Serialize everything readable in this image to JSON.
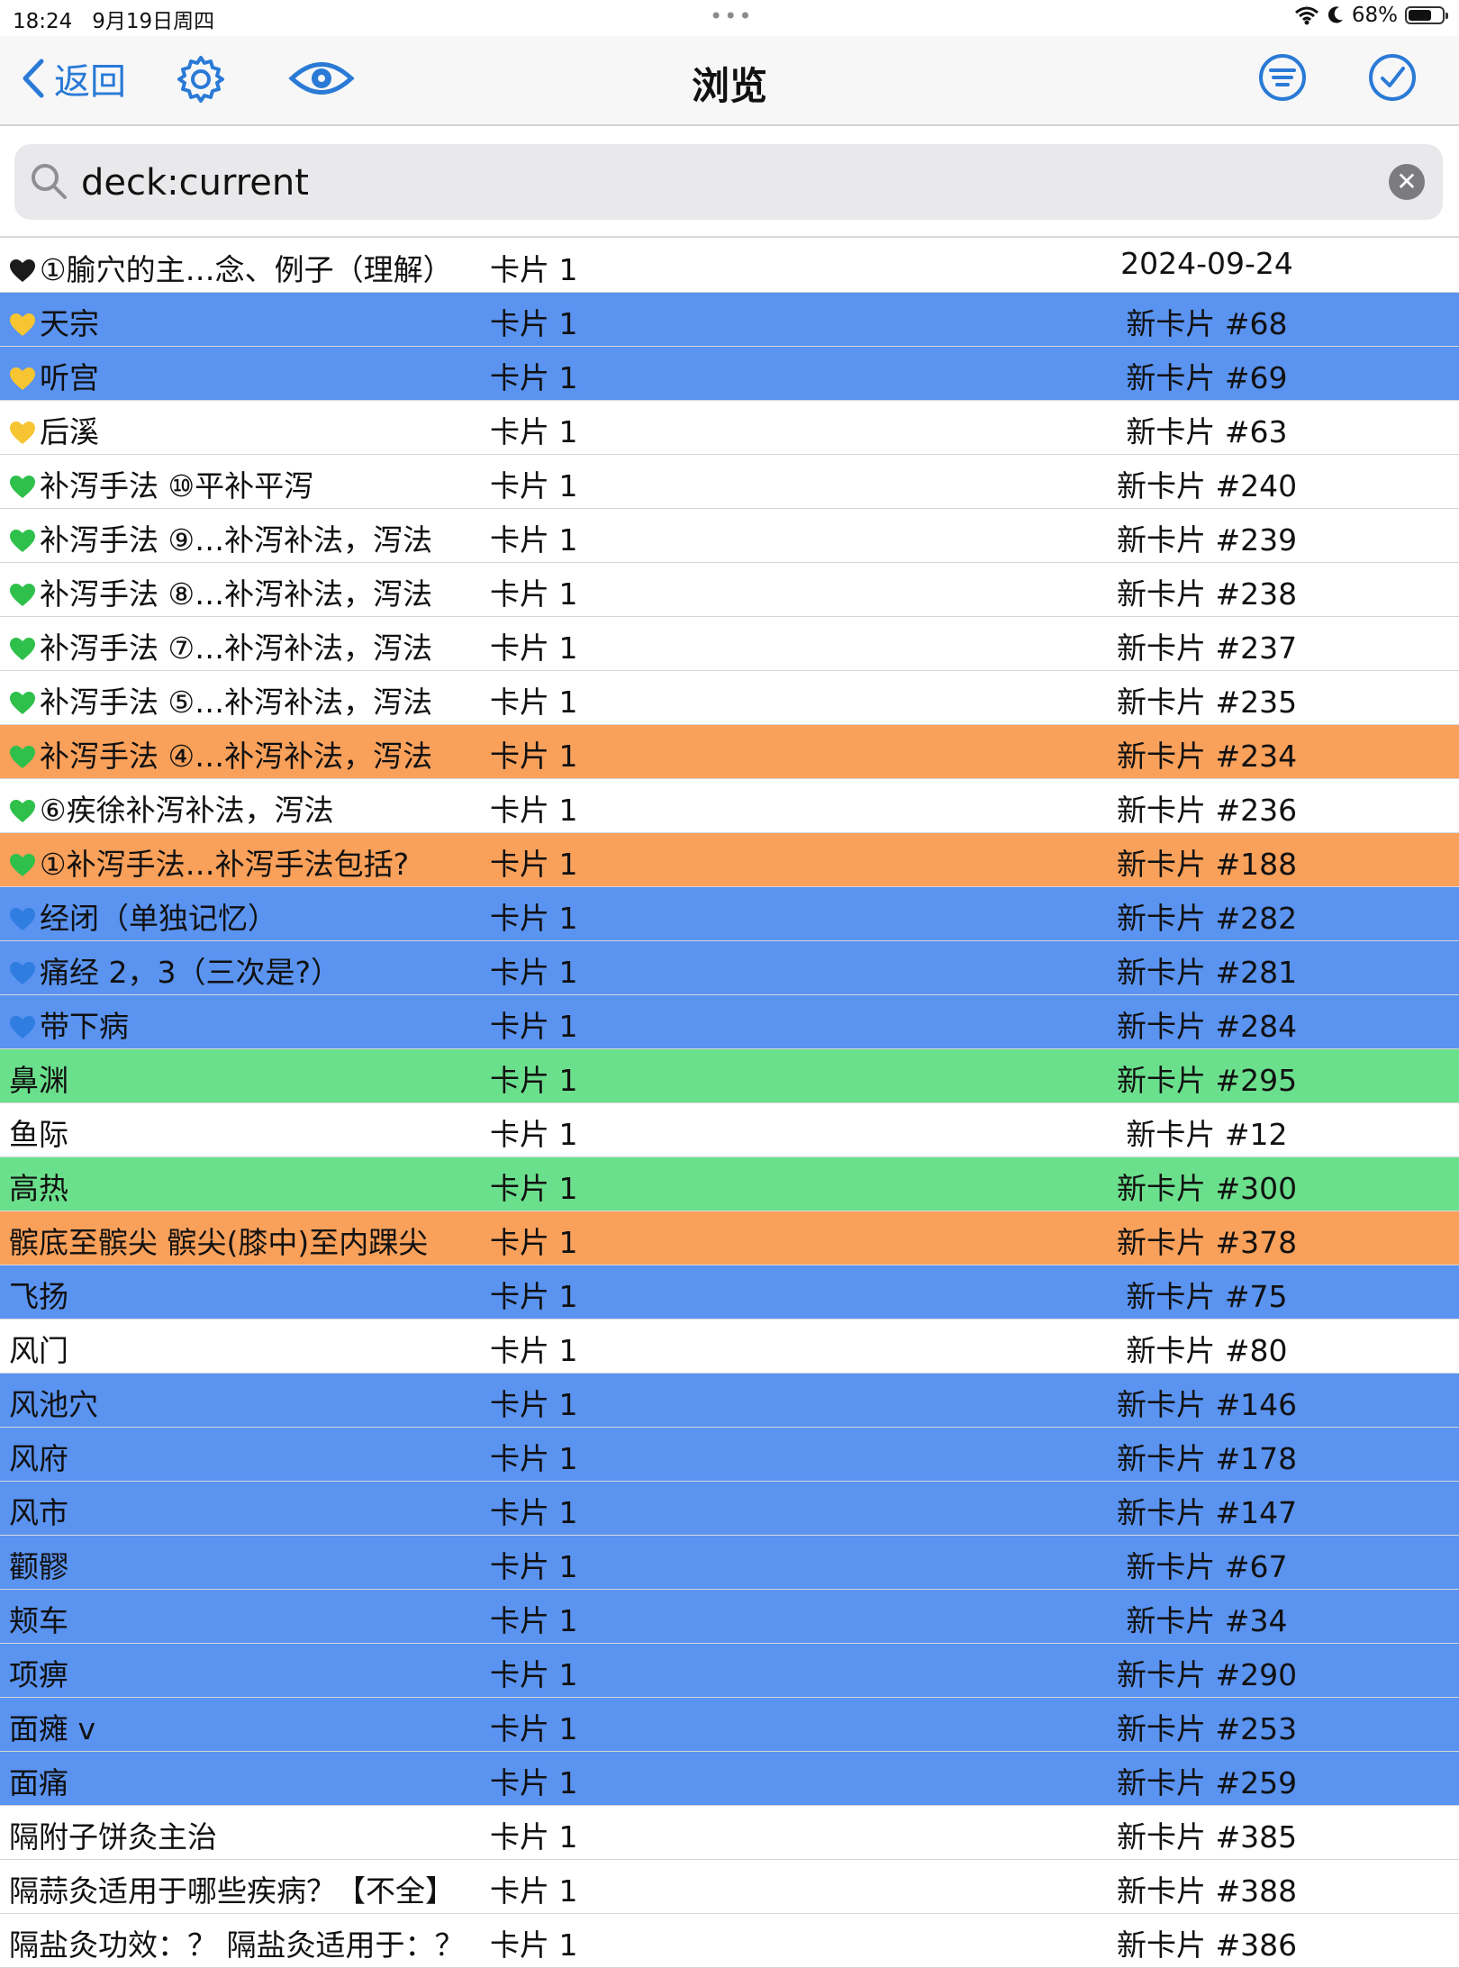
{
  "status": {
    "time": "18:24",
    "date": "9月19日周四",
    "battery": "68%"
  },
  "nav": {
    "back_label": "返回",
    "title": "浏览"
  },
  "search": {
    "value": "deck:current"
  },
  "colors": {
    "accent": "#2a7ad6",
    "blue": "#5a93f0",
    "orange": "#f9a05a",
    "green": "#6be08c",
    "white": "#ffffff"
  },
  "rows": [
    {
      "heart": "black",
      "label": "①腧穴的主…念、例子（理解）",
      "card": "卡片 1",
      "due": "2024-09-24",
      "bg": "white"
    },
    {
      "heart": "yellow",
      "label": "天宗",
      "card": "卡片 1",
      "due": "新卡片 #68",
      "bg": "blue"
    },
    {
      "heart": "yellow",
      "label": "听宫",
      "card": "卡片 1",
      "due": "新卡片 #69",
      "bg": "blue"
    },
    {
      "heart": "yellow",
      "label": "后溪",
      "card": "卡片 1",
      "due": "新卡片 #63",
      "bg": "white"
    },
    {
      "heart": "green",
      "label": "补泻手法 ⑩平补平泻",
      "card": "卡片 1",
      "due": "新卡片 #240",
      "bg": "white"
    },
    {
      "heart": "green",
      "label": "补泻手法 ⑨…补泻补法，泻法",
      "card": "卡片 1",
      "due": "新卡片 #239",
      "bg": "white"
    },
    {
      "heart": "green",
      "label": "补泻手法 ⑧…补泻补法，泻法",
      "card": "卡片 1",
      "due": "新卡片 #238",
      "bg": "white"
    },
    {
      "heart": "green",
      "label": "补泻手法 ⑦…补泻补法，泻法",
      "card": "卡片 1",
      "due": "新卡片 #237",
      "bg": "white"
    },
    {
      "heart": "green",
      "label": "补泻手法 ⑤…补泻补法，泻法",
      "card": "卡片 1",
      "due": "新卡片 #235",
      "bg": "white"
    },
    {
      "heart": "green",
      "label": "补泻手法 ④…补泻补法，泻法",
      "card": "卡片 1",
      "due": "新卡片 #234",
      "bg": "orange"
    },
    {
      "heart": "green",
      "label": "⑥疾徐补泻补法，泻法",
      "card": "卡片 1",
      "due": "新卡片 #236",
      "bg": "white"
    },
    {
      "heart": "green",
      "label": "①补泻手法…补泻手法包括?",
      "card": "卡片 1",
      "due": "新卡片 #188",
      "bg": "orange"
    },
    {
      "heart": "blue",
      "label": "经闭（单独记忆）",
      "card": "卡片 1",
      "due": "新卡片 #282",
      "bg": "blue"
    },
    {
      "heart": "blue",
      "label": "痛经 2，3（三次是?）",
      "card": "卡片 1",
      "due": "新卡片 #281",
      "bg": "blue"
    },
    {
      "heart": "blue",
      "label": "带下病",
      "card": "卡片 1",
      "due": "新卡片 #284",
      "bg": "blue"
    },
    {
      "heart": "",
      "label": "鼻渊",
      "card": "卡片 1",
      "due": "新卡片 #295",
      "bg": "green"
    },
    {
      "heart": "",
      "label": "鱼际",
      "card": "卡片 1",
      "due": "新卡片 #12",
      "bg": "white"
    },
    {
      "heart": "",
      "label": "高热",
      "card": "卡片 1",
      "due": "新卡片 #300",
      "bg": "green"
    },
    {
      "heart": "",
      "label": "髌底至髌尖  髌尖(膝中)至内踝尖",
      "card": "卡片 1",
      "due": "新卡片 #378",
      "bg": "orange"
    },
    {
      "heart": "",
      "label": "飞扬",
      "card": "卡片 1",
      "due": "新卡片 #75",
      "bg": "blue"
    },
    {
      "heart": "",
      "label": "风门",
      "card": "卡片 1",
      "due": "新卡片 #80",
      "bg": "white"
    },
    {
      "heart": "",
      "label": "风池穴",
      "card": "卡片 1",
      "due": "新卡片 #146",
      "bg": "blue"
    },
    {
      "heart": "",
      "label": "风府",
      "card": "卡片 1",
      "due": "新卡片 #178",
      "bg": "blue"
    },
    {
      "heart": "",
      "label": "风市",
      "card": "卡片 1",
      "due": "新卡片 #147",
      "bg": "blue"
    },
    {
      "heart": "",
      "label": "颧髎",
      "card": "卡片 1",
      "due": "新卡片 #67",
      "bg": "blue"
    },
    {
      "heart": "",
      "label": "颊车",
      "card": "卡片 1",
      "due": "新卡片 #34",
      "bg": "blue"
    },
    {
      "heart": "",
      "label": "项痹",
      "card": "卡片 1",
      "due": "新卡片 #290",
      "bg": "blue"
    },
    {
      "heart": "",
      "label": "面瘫 v",
      "card": "卡片 1",
      "due": "新卡片 #253",
      "bg": "blue"
    },
    {
      "heart": "",
      "label": "面痛",
      "card": "卡片 1",
      "due": "新卡片 #259",
      "bg": "blue"
    },
    {
      "heart": "",
      "label": "隔附子饼灸主治",
      "card": "卡片 1",
      "due": "新卡片 #385",
      "bg": "white"
    },
    {
      "heart": "",
      "label": "隔蒜灸适用于哪些疾病？【不全】",
      "card": "卡片 1",
      "due": "新卡片 #388",
      "bg": "white"
    },
    {
      "heart": "",
      "label": "隔盐灸功效：？  隔盐灸适用于：？",
      "card": "卡片 1",
      "due": "新卡片 #386",
      "bg": "white"
    }
  ]
}
